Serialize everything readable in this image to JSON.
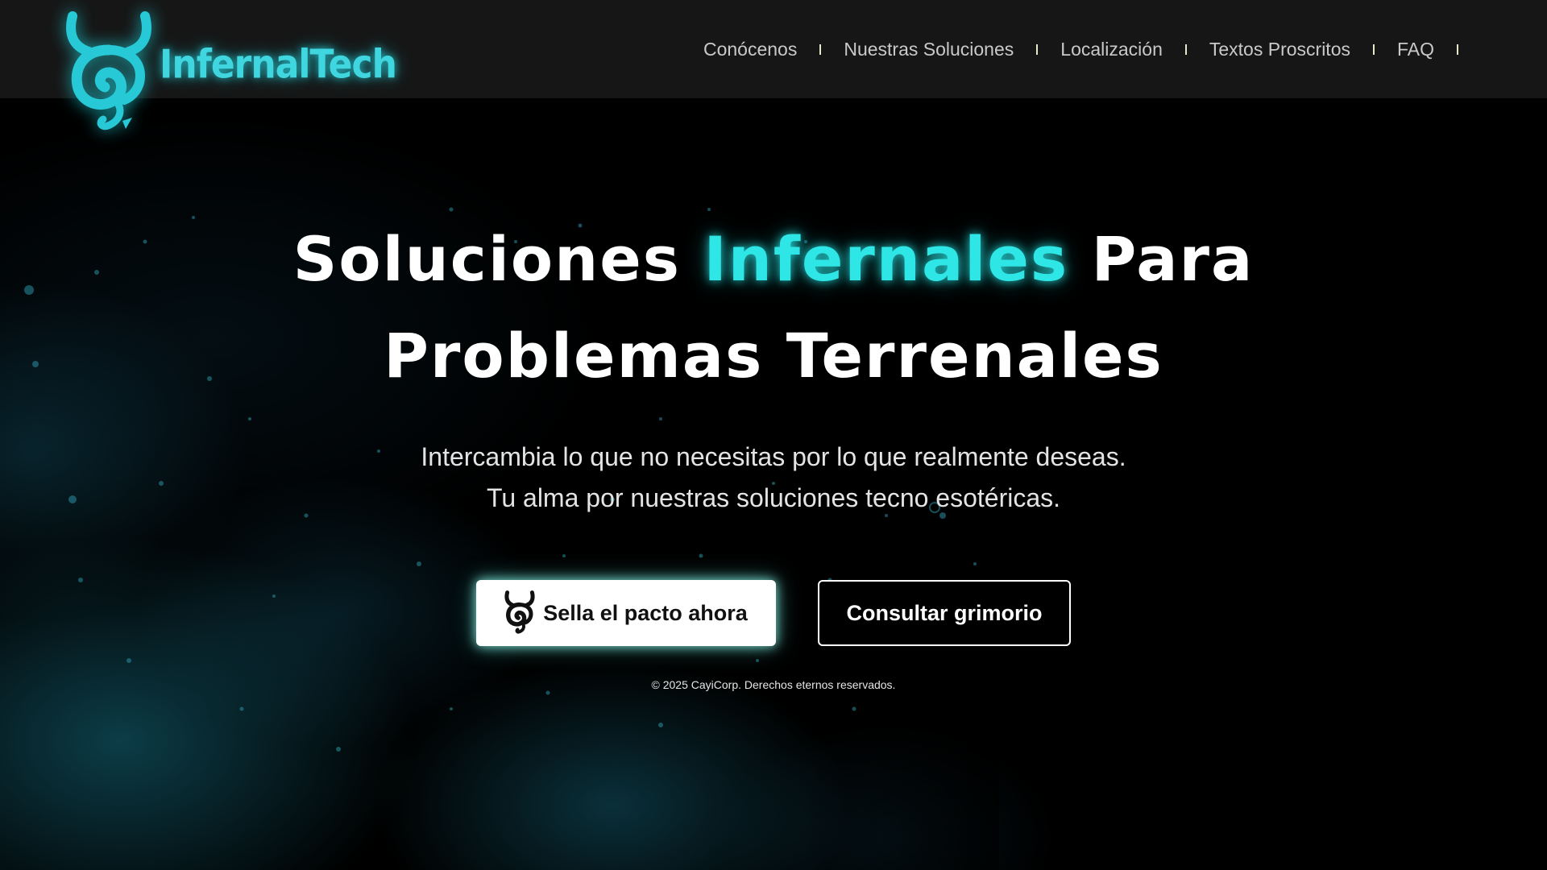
{
  "brand": {
    "name": "InfernalTech",
    "accent_color": "#2fe6e6",
    "logo_icon": "devil-swirl-icon"
  },
  "nav": {
    "items": [
      {
        "label": "Conócenos"
      },
      {
        "label": "Nuestras Soluciones"
      },
      {
        "label": "Localización"
      },
      {
        "label": "Textos Proscritos"
      },
      {
        "label": "FAQ"
      }
    ]
  },
  "hero": {
    "title_part1": "Soluciones ",
    "title_accent": "Infernales",
    "title_part2": " Para",
    "title_line2": "Problemas Terrenales",
    "subtitle_line1": "Intercambia lo que no necesitas por lo que realmente deseas.",
    "subtitle_line2": "Tu alma por nuestras soluciones tecno esotéricas."
  },
  "cta": {
    "primary_label": "Sella el pacto ahora",
    "primary_icon": "devil-swirl-icon",
    "secondary_label": "Consultar grimorio"
  },
  "footer": {
    "copyright": "© 2025 CayiCorp. Derechos eternos reservados."
  }
}
